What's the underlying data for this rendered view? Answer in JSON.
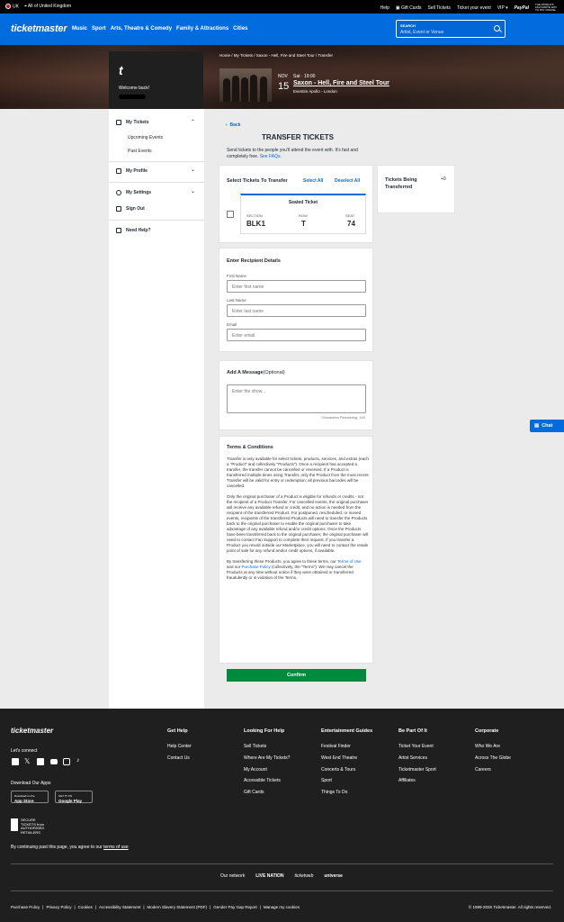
{
  "topbar": {
    "region": "UK",
    "country": "All of United Kingdom",
    "links": [
      "Help",
      "Gift Cards",
      "Sell Tickets",
      "Ticket your event",
      "VIP"
    ],
    "paypal": "PayPal",
    "paypal_note": "THE WORLD'S FAVOURITE WAY TO PAY ONLINE"
  },
  "nav": {
    "logo": "ticketmaster",
    "links": [
      "Music",
      "Sport",
      "Arts, Theatre & Comedy",
      "Family & Attractions",
      "Cities"
    ],
    "search_label": "SEARCH",
    "search_placeholder": "Artist, Event or Venue"
  },
  "hero": {
    "avatar_letter": "t",
    "welcome": "Welcome back!",
    "breadcrumb": "Home / My Tickets / Saxon - Hell, Fire and Steel Tour / Transfer",
    "event_month": "NOV",
    "event_day": "15",
    "event_time": "Sat · 19:00",
    "event_title": "Saxon - Hell, Fire and Steel Tour",
    "event_venue": "Eventim Apollo - London"
  },
  "sidebar": {
    "my_tickets": "My Tickets",
    "upcoming": "Upcoming Events",
    "past": "Past Events",
    "my_profile": "My Profile",
    "my_settings": "My Settings",
    "sign_out": "Sign Out",
    "need_help": "Need Help?"
  },
  "transfer": {
    "back": "Back",
    "title": "TRANSFER TICKETS",
    "desc": "Send tickets to the people you'll attend the event with. It's fast and completely free.",
    "faqs": "See FAQs.",
    "select_title": "Select Tickets To Transfer",
    "select_all": "Select All",
    "deselect_all": "Deselect All",
    "ticket_type": "Seated Ticket",
    "section_label": "SECTION",
    "section": "BLK1",
    "row_label": "ROW",
    "row": "T",
    "seat_label": "SEAT",
    "seat": "74",
    "being_transferred": "Tickets Being Transferred",
    "count": "+0"
  },
  "recipient": {
    "title": "Enter Recipient Details",
    "first_label": "First Name",
    "first_ph": "Enter first name",
    "last_label": "Last Name",
    "last_ph": "Enter last name",
    "email_label": "Email",
    "email_ph": "Enter email"
  },
  "message": {
    "title": "Add A Message",
    "optional": "(Optional)",
    "ph": "Enter the show...",
    "remaining": "Characters Remaining: 140"
  },
  "terms": {
    "title": "Terms & Conditions",
    "p1": "Transfer is only available for select tickets, products, services, and extras (each a \"Product\" and collectively \"Products\"). Once a recipient has accepted a transfer, the transfer cannot be cancelled or reversed. If a Product is transferred multiple times using Transfer, only the Product from the most recent Transfer will be valid for entry or redemption; all previous barcodes will be cancelled.",
    "p2": "Only the original purchaser of a Product is eligible for refunds or credits - not the recipient of a Product Transfer. For cancelled events, the original purchaser will receive any available refund or credit, and no action is needed from the recipient of the transferred Product. For postponed, rescheduled, or moved events, recipients of the transferred Products will need to transfer the Products back to the original purchaser to enable the original purchaser to take advantage of any available refund and/or credit options. Once the Products have been transferred back to the original purchaser, the original purchaser will need to contact Fan Support to complete their request. If you transfer a Product you resold outside our Marketplace, you will need to contact the resale point of sale for any refund and/or credit options, if available.",
    "p3a": "By transferring these Products, you agree to these terms, our",
    "tou": "Terms of Use",
    "p3b": "and our",
    "pp": "Purchase Policy",
    "p3c": "(collectively, the \"Terms\"). We may cancel the Products at any time without notice if they were obtained or transferred fraudulently or in violation of the Terms."
  },
  "confirm": "Confirm",
  "chat": "Chat",
  "footer": {
    "logo": "ticketmaster",
    "connect": "Let's connect",
    "apps": "Download Our Apps",
    "appstore": "App Store",
    "appstore_small": "Download on the",
    "googleplay": "Google Play",
    "googleplay_small": "GET IT ON",
    "secure": "SECURE TICKETS from AUTHORISED RETAILERS",
    "consent_a": "By continuing past this page, you agree to our",
    "consent_link": "terms of use",
    "cols": [
      {
        "h": "Get Help",
        "items": [
          "Help Center",
          "Contact Us"
        ]
      },
      {
        "h": "Looking For Help",
        "items": [
          "Sell Tickets",
          "Where Are My Tickets?",
          "My Account",
          "Accessible Tickets",
          "Gift Cards"
        ]
      },
      {
        "h": "Entertainment Guides",
        "items": [
          "Festival Finder",
          "West End Theatre",
          "Concerts & Tours",
          "Sport",
          "Things To Do"
        ]
      },
      {
        "h": "Be Part Of It",
        "items": [
          "Ticket Your Event",
          "Artist Services",
          "Ticketmaster Sport",
          "Affiliates"
        ]
      },
      {
        "h": "Corporate",
        "items": [
          "Who We Are",
          "Across The Globe",
          "Careers"
        ]
      }
    ],
    "network_label": "Our network",
    "network": [
      "LIVE NATION",
      "ticketweb",
      "universe"
    ],
    "legal": [
      "Purchase Policy",
      "Privacy Policy",
      "Cookies",
      "Accessibility Statement",
      "Modern Slavery Statement (PDF)",
      "Gender Pay Gap Report",
      "Manage my cookies"
    ],
    "copyright": "© 1999-2025 Ticketmaster. All rights reserved."
  }
}
